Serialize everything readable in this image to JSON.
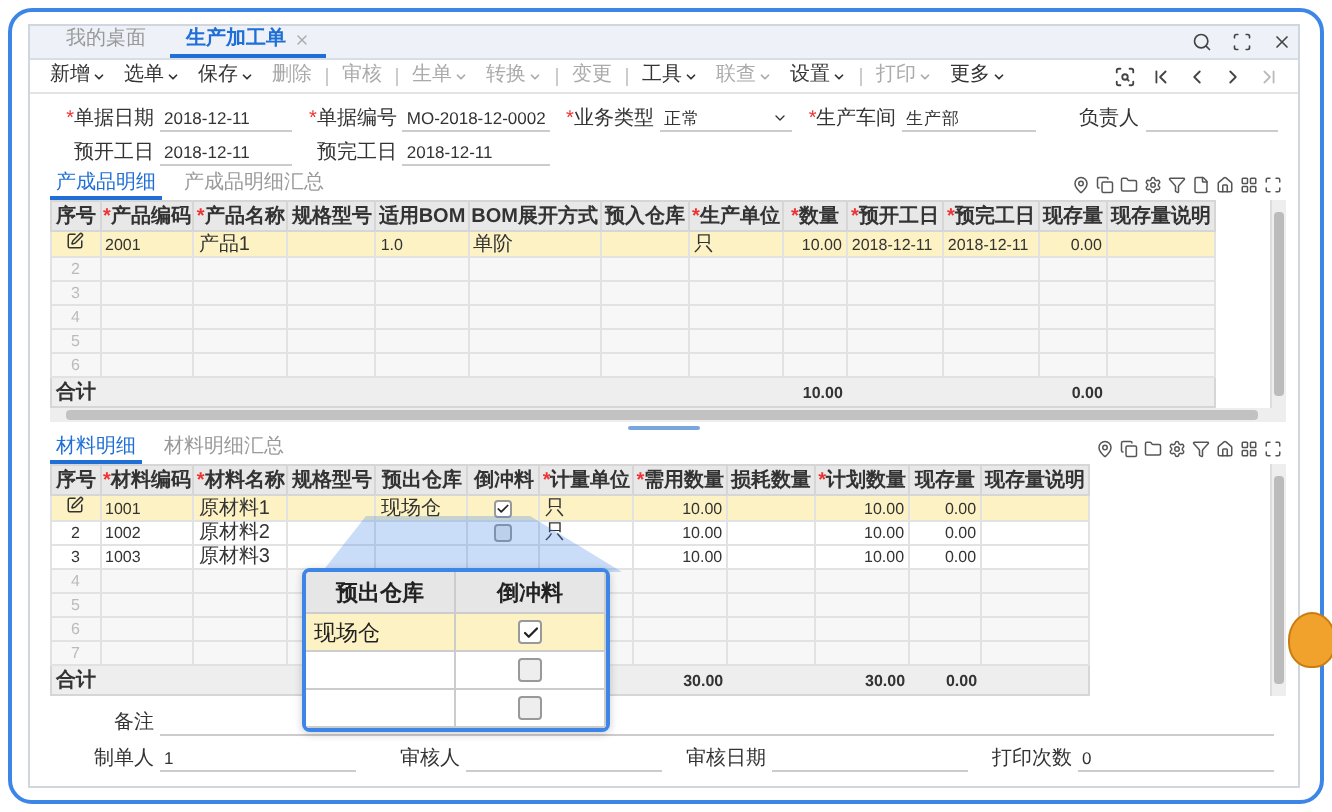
{
  "tabs": [
    {
      "label": "我的桌面",
      "selected": false,
      "closable": false
    },
    {
      "label": "生产加工单",
      "selected": true,
      "closable": true
    }
  ],
  "toolbar": [
    {
      "kind": "button",
      "label": "新增",
      "menu": true,
      "disabled": false
    },
    {
      "kind": "button",
      "label": "选单",
      "menu": true,
      "disabled": false
    },
    {
      "kind": "button",
      "label": "保存",
      "menu": true,
      "disabled": false
    },
    {
      "kind": "button",
      "label": "删除",
      "menu": false,
      "disabled": true
    },
    {
      "kind": "separator"
    },
    {
      "kind": "button",
      "label": "审核",
      "menu": false,
      "disabled": true
    },
    {
      "kind": "separator"
    },
    {
      "kind": "button",
      "label": "生单",
      "menu": true,
      "disabled": true
    },
    {
      "kind": "button",
      "label": "转换",
      "menu": true,
      "disabled": true
    },
    {
      "kind": "separator"
    },
    {
      "kind": "button",
      "label": "变更",
      "menu": false,
      "disabled": true
    },
    {
      "kind": "separator"
    },
    {
      "kind": "button",
      "label": "工具",
      "menu": true,
      "disabled": false
    },
    {
      "kind": "button",
      "label": "联查",
      "menu": true,
      "disabled": true
    },
    {
      "kind": "button",
      "label": "设置",
      "menu": true,
      "disabled": false
    },
    {
      "kind": "separator"
    },
    {
      "kind": "button",
      "label": "打印",
      "menu": true,
      "disabled": true
    },
    {
      "kind": "button",
      "label": "更多",
      "menu": true,
      "disabled": false
    }
  ],
  "form": [
    [
      {
        "label": "单据日期",
        "mark": "*",
        "value": "2018-12-11",
        "kind": "text"
      },
      {
        "label": "单据编号",
        "mark": "*",
        "value": "MO-2018-12-0002",
        "kind": "text"
      },
      {
        "label": "业务类型",
        "mark": "*",
        "value": "正常",
        "kind": "select"
      },
      {
        "label": "生产车间",
        "mark": "*",
        "value": "生产部",
        "kind": "text"
      },
      {
        "label": "负责人",
        "kind": "text"
      }
    ],
    [
      {
        "label": "预开工日",
        "value": "2018-12-11",
        "kind": "text"
      },
      {
        "label": "预完工日",
        "value": "2018-12-11",
        "kind": "text"
      }
    ]
  ],
  "product_section": {
    "tabs": [
      {
        "label": "产成品明细",
        "selected": true
      },
      {
        "label": "产成品明细汇总",
        "selected": false
      }
    ],
    "table": {
      "columns": [
        {
          "label": "序号"
        },
        {
          "label": "产品编码",
          "mark": "*",
          "kind": "text"
        },
        {
          "label": "产品名称",
          "mark": "*",
          "kind": "text"
        },
        {
          "label": "规格型号",
          "kind": "text"
        },
        {
          "label": "适用BOM",
          "kind": "text"
        },
        {
          "label": "BOM展开方式",
          "kind": "text"
        },
        {
          "label": "预入仓库",
          "kind": "text"
        },
        {
          "label": "生产单位",
          "mark": "*",
          "kind": "text"
        },
        {
          "label": "数量",
          "mark": "*",
          "kind": "number"
        },
        {
          "label": "预开工日",
          "mark": "*",
          "kind": "text"
        },
        {
          "label": "预完工日",
          "mark": "*",
          "kind": "text"
        },
        {
          "label": "现存量",
          "kind": "number"
        },
        {
          "label": "现存量说明",
          "kind": "text"
        }
      ],
      "rows": [
        {
          "selected": true,
          "empty": false,
          "cells": [
            {
              "text": "2001"
            },
            {
              "text": "产品1"
            },
            {},
            {
              "text": "1.0"
            },
            {
              "text": "单阶"
            },
            {},
            {
              "text": "只"
            },
            {
              "text": "10.00"
            },
            {
              "text": "2018-12-11"
            },
            {
              "text": "2018-12-11"
            },
            {
              "text": "0.00"
            },
            {}
          ]
        },
        {
          "selected": false,
          "empty": true,
          "no": "2"
        },
        {
          "selected": false,
          "empty": true,
          "no": "3"
        },
        {
          "selected": false,
          "empty": true,
          "no": "4"
        },
        {
          "selected": false,
          "empty": true,
          "no": "5"
        },
        {
          "selected": false,
          "empty": true,
          "no": "6"
        }
      ],
      "totals": {
        "label": "合计",
        "cells": [
          {},
          {},
          {},
          {},
          {},
          {},
          {},
          {
            "text": "10.00"
          },
          {},
          {},
          {
            "text": "0.00"
          },
          {}
        ]
      }
    }
  },
  "material_section": {
    "tabs": [
      {
        "label": "材料明细",
        "selected": true
      },
      {
        "label": "材料明细汇总",
        "selected": false
      }
    ],
    "table": {
      "columns": [
        {
          "label": "序号"
        },
        {
          "label": "材料编码",
          "mark": "*",
          "kind": "text"
        },
        {
          "label": "材料名称",
          "mark": "*",
          "kind": "text"
        },
        {
          "label": "规格型号",
          "kind": "text"
        },
        {
          "label": "预出仓库",
          "kind": "text"
        },
        {
          "label": "倒冲料",
          "kind": "check"
        },
        {
          "label": "计量单位",
          "mark": "*",
          "kind": "text"
        },
        {
          "label": "需用数量",
          "mark": "*",
          "kind": "number"
        },
        {
          "label": "损耗数量",
          "kind": "number"
        },
        {
          "label": "计划数量",
          "mark": "*",
          "kind": "number"
        },
        {
          "label": "现存量",
          "kind": "number"
        },
        {
          "label": "现存量说明",
          "kind": "text"
        }
      ],
      "rows": [
        {
          "selected": true,
          "empty": false,
          "cells": [
            {
              "text": "1001"
            },
            {
              "text": "原材料1"
            },
            {},
            {
              "text": "现场仓"
            },
            {
              "checked": true
            },
            {
              "text": "只"
            },
            {
              "text": "10.00"
            },
            {},
            {
              "text": "10.00"
            },
            {
              "text": "0.00"
            },
            {}
          ]
        },
        {
          "selected": false,
          "empty": false,
          "no": "2",
          "cells": [
            {
              "text": "1002"
            },
            {
              "text": "原材料2"
            },
            {},
            {},
            {
              "checked": false
            },
            {
              "text": "只"
            },
            {
              "text": "10.00"
            },
            {},
            {
              "text": "10.00"
            },
            {
              "text": "0.00"
            },
            {}
          ]
        },
        {
          "selected": false,
          "empty": false,
          "no": "3",
          "cells": [
            {
              "text": "1003"
            },
            {
              "text": "原材料3"
            },
            {},
            {},
            {},
            {},
            {
              "text": "10.00"
            },
            {},
            {
              "text": "10.00"
            },
            {
              "text": "0.00"
            },
            {}
          ]
        },
        {
          "selected": false,
          "empty": true,
          "no": "4"
        },
        {
          "selected": false,
          "empty": true,
          "no": "5"
        },
        {
          "selected": false,
          "empty": true,
          "no": "6"
        },
        {
          "selected": false,
          "empty": true,
          "no": "7"
        }
      ],
      "totals": {
        "label": "合计",
        "cells": [
          {},
          {},
          {},
          {},
          {},
          {},
          {
            "text": "30.00"
          },
          {},
          {
            "text": "30.00"
          },
          {
            "text": "0.00"
          },
          {}
        ]
      }
    },
    "magnifier": {
      "columns": [
        "预出仓库",
        "倒冲料"
      ],
      "rows": [
        {
          "warehouse": "现场仓",
          "backflush": true,
          "selected": true
        },
        {
          "backflush": false,
          "selected": false
        },
        {
          "backflush": false,
          "selected": false
        }
      ]
    }
  },
  "footer": [
    [
      {
        "label": "备注",
        "kind": "wide"
      }
    ],
    [
      {
        "label": "制单人",
        "value": "1",
        "kind": "text"
      },
      {
        "label": "审核人",
        "kind": "text"
      },
      {
        "label": "审核日期",
        "kind": "text"
      },
      {
        "label": "打印次数",
        "value": "0",
        "kind": "text"
      }
    ]
  ]
}
